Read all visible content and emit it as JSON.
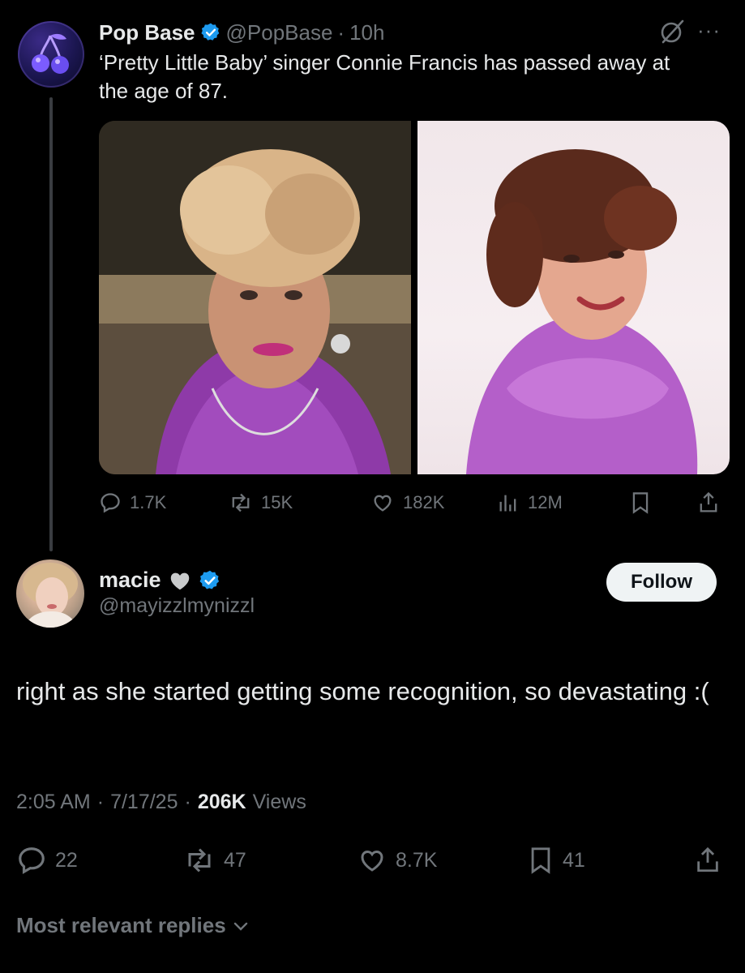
{
  "parent_tweet": {
    "author_name": "Pop Base",
    "handle": "@PopBase",
    "separator": "·",
    "time": "10h",
    "text": "‘Pretty Little Baby’ singer Connie Francis has passed away at the age of 87.",
    "more_label": "···",
    "stats": {
      "replies": "1.7K",
      "reposts": "15K",
      "likes": "182K",
      "views": "12M"
    }
  },
  "reply_tweet": {
    "author_name": "macie",
    "handle": "@mayizzlmynizzl",
    "follow_label": "Follow",
    "text": "right as she started getting some recognition, so devastating :(",
    "time": "2:05 AM",
    "date": "7/17/25",
    "separator": "·",
    "views_count": "206K",
    "views_label": "Views",
    "stats": {
      "replies": "22",
      "reposts": "47",
      "likes": "8.7K",
      "bookmarks": "41"
    }
  },
  "footer": {
    "sort_label": "Most relevant replies"
  },
  "colors": {
    "background": "#000000",
    "text_primary": "#e7e9ea",
    "text_secondary": "#71767b",
    "verified_blue": "#1d9bf0",
    "follow_bg": "#eff3f4"
  }
}
